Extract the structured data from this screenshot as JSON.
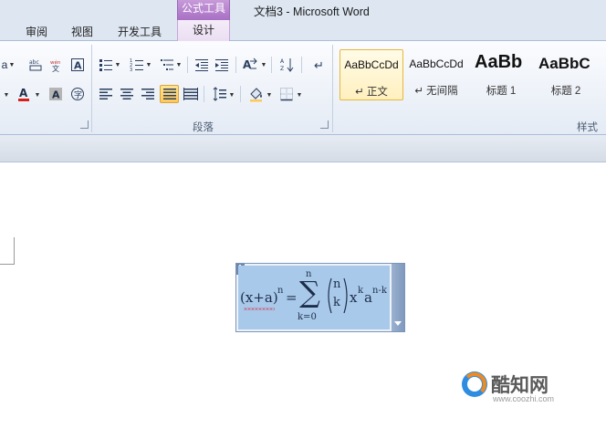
{
  "window": {
    "title": "文档3 - Microsoft Word",
    "context_group": "公式工具"
  },
  "tabs": [
    {
      "label": "审阅"
    },
    {
      "label": "视图"
    },
    {
      "label": "开发工具"
    },
    {
      "label": "设计",
      "active": true
    }
  ],
  "ribbon": {
    "groups": {
      "paragraph": "段落",
      "styles": "样式"
    },
    "font_fragment": "a",
    "font_color": "#d81e1e",
    "highlight_color": "#ffc85a",
    "styles_gallery": [
      {
        "sample": "AaBbCcDd",
        "name": "↵ 正文",
        "selected": true
      },
      {
        "sample": "AaBbCcDd",
        "name": "↵ 无间隔",
        "selected": false
      },
      {
        "sample": "AaBb",
        "name": "标题 1",
        "selected": false
      },
      {
        "sample": "AaBbC",
        "name": "标题 2",
        "selected": false
      }
    ]
  },
  "equation": {
    "lhs": "(x+a)",
    "lhs_exp": "n",
    "equals": "=",
    "sum_symbol": "∑",
    "sum_upper": "n",
    "sum_lower": "k=0",
    "binom_top": "n",
    "binom_bottom": "k",
    "term_x": "x",
    "term_x_exp": "k",
    "term_a": "a",
    "term_a_exp": "n-k",
    "selection_color": "#a9c9ea"
  },
  "watermark": {
    "brand": "酷知网",
    "url": "www.coozhi.com"
  }
}
